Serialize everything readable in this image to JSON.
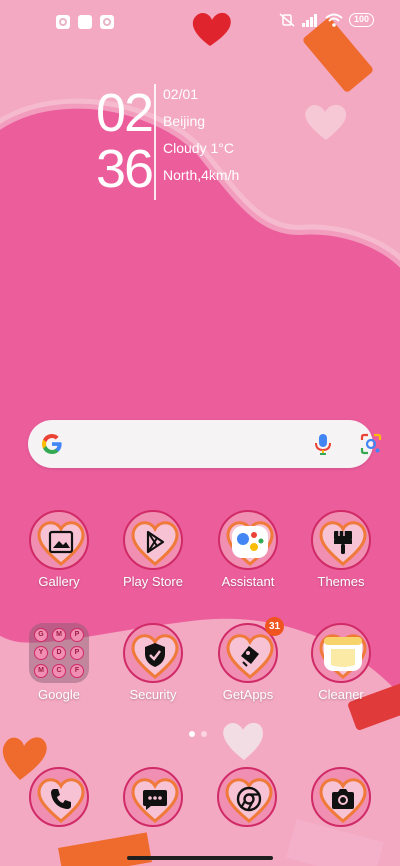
{
  "status_bar": {
    "notification_icons": [
      "app-notification-icon",
      "square-notification-icon",
      "app-notification-icon"
    ],
    "battery_level": "100",
    "icons": [
      "mute-vibrate-icon",
      "signal-icon",
      "wifi-icon",
      "battery-icon"
    ]
  },
  "clock": {
    "hours": "02",
    "minutes": "36",
    "date": "02/01",
    "city": "Beijing",
    "condition": "Cloudy 1°C",
    "wind": "North,4km/h"
  },
  "search": {
    "icons": [
      "google-g-icon",
      "microphone-icon",
      "google-lens-icon"
    ]
  },
  "apps": [
    {
      "label": "Gallery",
      "icon": "gallery-icon"
    },
    {
      "label": "Play Store",
      "icon": "play-store-icon"
    },
    {
      "label": "Assistant",
      "icon": "assistant-icon"
    },
    {
      "label": "Themes",
      "icon": "paintbrush-icon"
    },
    {
      "label": "Google",
      "icon": "folder-icon"
    },
    {
      "label": "Security",
      "icon": "shield-check-icon"
    },
    {
      "label": "GetApps",
      "icon": "getapps-icon",
      "badge": "31"
    },
    {
      "label": "Cleaner",
      "icon": "cleaner-icon"
    }
  ],
  "folder_contents": [
    "G",
    "M",
    "P",
    "Y",
    "D",
    "P",
    "M",
    "C",
    "F"
  ],
  "dock": [
    {
      "icon": "phone-icon"
    },
    {
      "icon": "messages-icon"
    },
    {
      "icon": "chrome-icon"
    },
    {
      "icon": "camera-icon"
    }
  ],
  "pages": {
    "current": 1,
    "total": 2
  },
  "colors": {
    "wallpaper_bg": "#f4a9c2",
    "big_heart": "#ec5d9c",
    "icon_ring": "#d02a67",
    "icon_fill": "#f08fb2",
    "badge": "#f0541f"
  }
}
